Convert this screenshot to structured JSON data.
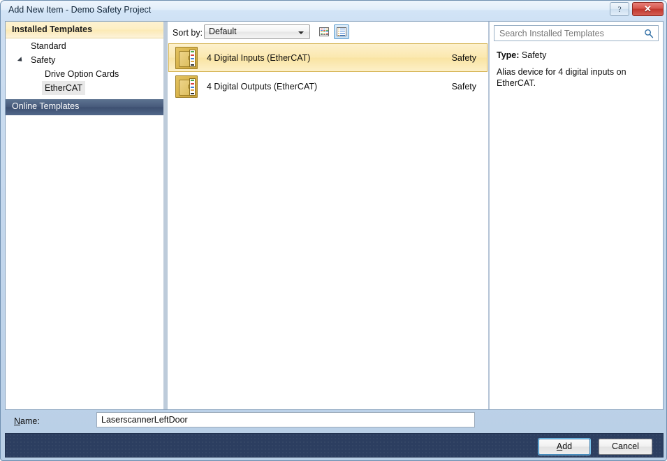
{
  "window": {
    "title": "Add New Item - Demo Safety Project",
    "help_button": "?",
    "close_button": "✕"
  },
  "sidebar": {
    "installed_header": "Installed Templates",
    "online_header": "Online Templates",
    "items": [
      {
        "label": "Standard",
        "level": 1,
        "expander": false,
        "selected": false
      },
      {
        "label": "Safety",
        "level": 1,
        "expander": true,
        "selected": false
      },
      {
        "label": "Drive Option Cards",
        "level": 2,
        "expander": false,
        "selected": false
      },
      {
        "label": "EtherCAT",
        "level": 2,
        "expander": false,
        "selected": true
      }
    ]
  },
  "toolbar": {
    "sort_by_label": "Sort by:",
    "sort_value": "Default",
    "view_icons_title": "Medium Icons",
    "view_list_title": "List"
  },
  "list": {
    "items": [
      {
        "title": "4 Digital Inputs (EtherCAT)",
        "category": "Safety",
        "selected": true
      },
      {
        "title": "4 Digital Outputs (EtherCAT)",
        "category": "Safety",
        "selected": false
      }
    ]
  },
  "search": {
    "placeholder": "Search Installed Templates",
    "value": ""
  },
  "details": {
    "type_label": "Type:",
    "type_value": "Safety",
    "description": "Alias device for 4 digital inputs on EtherCAT."
  },
  "name_row": {
    "label_prefix": "",
    "label_accel": "N",
    "label_suffix": "ame:",
    "value": "LaserscannerLeftDoor"
  },
  "footer": {
    "add_accel": "A",
    "add_suffix": "dd",
    "cancel_label": "Cancel"
  },
  "colors": {
    "accent_blue": "#3c7fb1",
    "selection_gold": "#f9e3a2",
    "online_header_blue": "#46597a",
    "footer_navy": "#2c3e60",
    "close_red": "#c0362c"
  }
}
